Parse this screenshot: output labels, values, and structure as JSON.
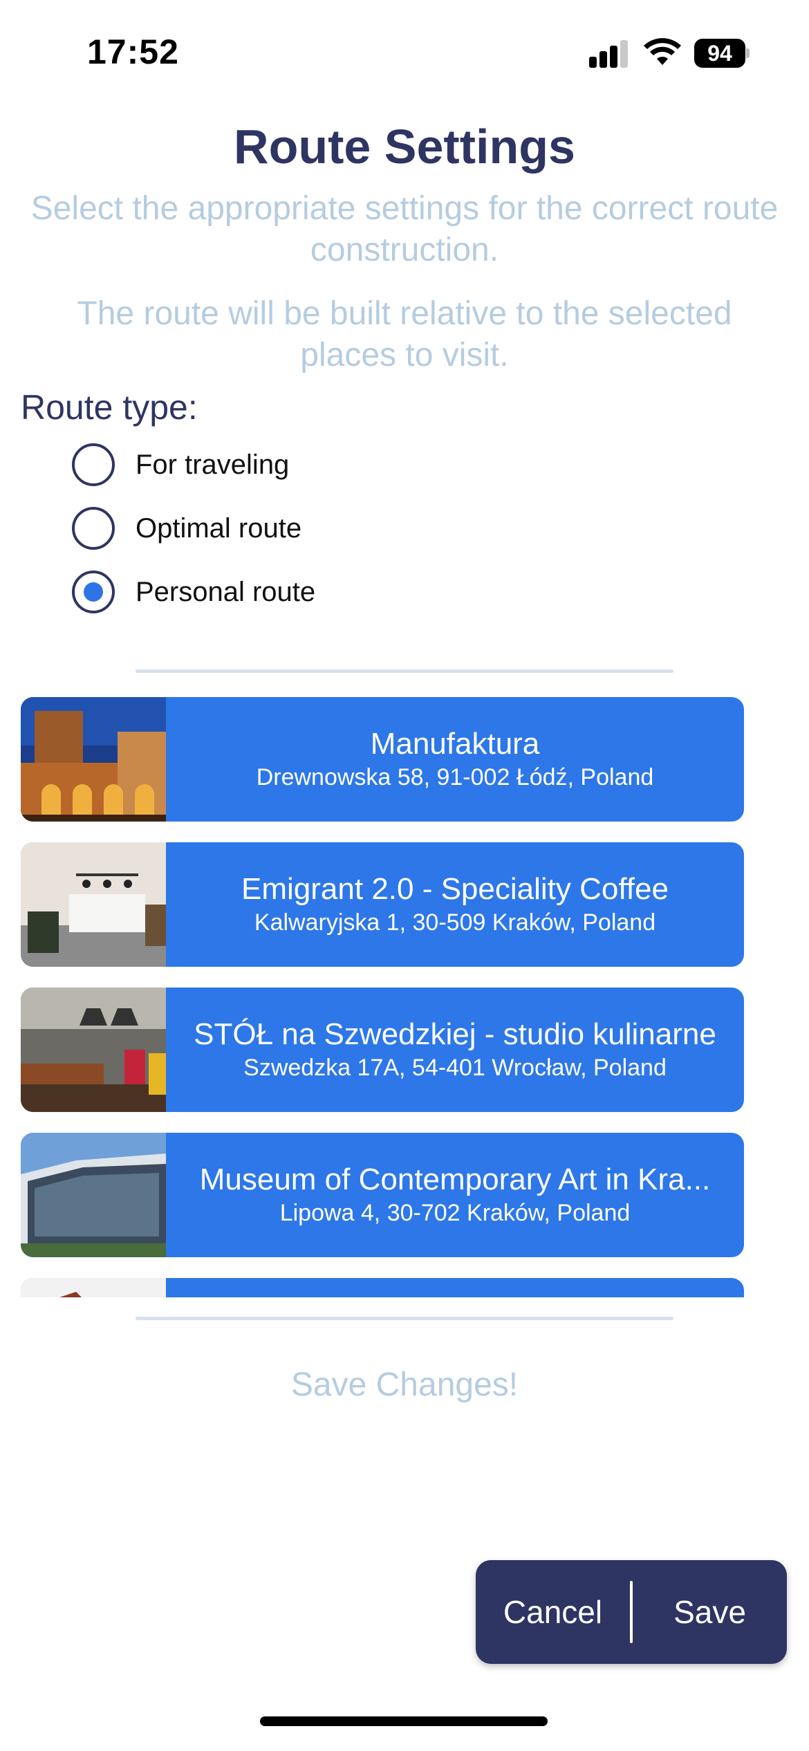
{
  "status_bar": {
    "time": "17:52",
    "battery": "94",
    "icons": [
      "signal-icon",
      "wifi-icon",
      "battery-icon"
    ]
  },
  "header": {
    "title": "Route Settings",
    "subtitle_1": "Select the appropriate settings for the correct route construction.",
    "subtitle_2": "The route will be built relative to the selected places to visit."
  },
  "route_type": {
    "label": "Route type:",
    "options": [
      {
        "label": "For traveling",
        "selected": false
      },
      {
        "label": "Optimal route",
        "selected": false
      },
      {
        "label": "Personal route",
        "selected": true
      }
    ]
  },
  "places": [
    {
      "name": "Manufaktura",
      "address": "Drewnowska 58, 91-002 Łódź, Poland",
      "image": "historic-brick-building"
    },
    {
      "name": "Emigrant 2.0 - Speciality Coffee",
      "address": "Kalwaryjska 1, 30-509 Kraków, Poland",
      "image": "cafe-interior"
    },
    {
      "name": "STÓŁ na Szwedzkiej - studio kulinarne",
      "address": "Szwedzka 17A, 54-401 Wrocław, Poland",
      "image": "kitchen-studio"
    },
    {
      "name": "Museum of Contemporary Art in Kra...",
      "address": "Lipowa 4, 30-702 Kraków, Poland",
      "image": "modern-glass-building"
    },
    {
      "name": "",
      "address": "",
      "image": "partial"
    }
  ],
  "save_changes_label": "Save Changes!",
  "actions": {
    "cancel": "Cancel",
    "save": "Save"
  },
  "colors": {
    "primary_dark": "#2e3562",
    "accent_blue": "#2d77e8",
    "muted_text": "#b5cce0",
    "divider": "#d6e1ec"
  }
}
